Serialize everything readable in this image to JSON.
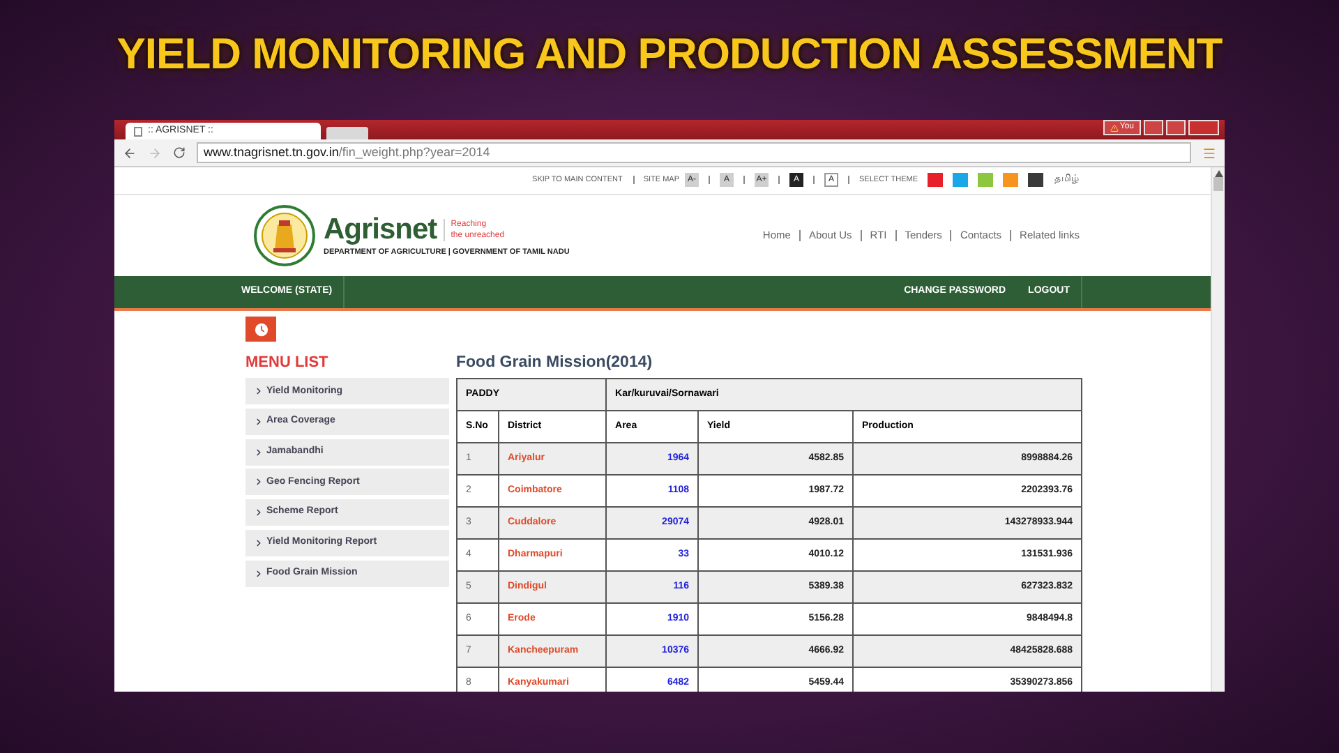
{
  "slide": {
    "title": "YIELD MONITORING AND PRODUCTION ASSESSMENT"
  },
  "browser": {
    "tab_title": ":: AGRISNET ::",
    "profile": "You",
    "url_host": "www.tnagrisnet.tn.gov.in",
    "url_path": "/fin_weight.php?year=2014"
  },
  "utility_bar": {
    "skip_link": "SKIP TO MAIN CONTENT",
    "site_map": "SITE MAP",
    "font_buttons": [
      {
        "label": "A-",
        "kind": "light"
      },
      {
        "label": "A",
        "kind": "light"
      },
      {
        "label": "A+",
        "kind": "light"
      },
      {
        "label": "A",
        "kind": "dark"
      },
      {
        "label": "A",
        "kind": "white"
      }
    ],
    "theme_label": "SELECT THEME",
    "themes": [
      {
        "color": "#e8202a"
      },
      {
        "color": "#1aa7e8"
      },
      {
        "color": "#8dc63f"
      },
      {
        "color": "#f7941d"
      },
      {
        "color": "#3a3a3a"
      }
    ],
    "language": "தமிழ்"
  },
  "header": {
    "brand": "Agrisnet",
    "tagline": [
      "Reaching",
      "the unreached"
    ],
    "department": "DEPARTMENT OF AGRICULTURE | GOVERNMENT OF TAMIL NADU",
    "links": [
      "Home",
      "About Us",
      "RTI",
      "Tenders",
      "Contacts",
      "Related links"
    ]
  },
  "nav": {
    "welcome": "WELCOME (STATE)",
    "right": [
      "CHANGE PASSWORD",
      "LOGOUT"
    ]
  },
  "menu": {
    "title": "MENU LIST",
    "items": [
      "Yield Monitoring",
      "Area Coverage",
      "Jamabandhi",
      "Geo Fencing Report",
      "Scheme Report",
      "Yield Monitoring Report",
      "Food Grain Mission"
    ]
  },
  "content": {
    "title": "Food Grain Mission(2014)",
    "table": {
      "group_row": [
        "PADDY",
        "Kar/kuruvai/Sornawari"
      ],
      "columns": [
        "S.No",
        "District",
        "Area",
        "Yield",
        "Production"
      ],
      "rows": [
        [
          "1",
          "Ariyalur",
          "1964",
          "4582.85",
          "8998884.26"
        ],
        [
          "2",
          "Coimbatore",
          "1108",
          "1987.72",
          "2202393.76"
        ],
        [
          "3",
          "Cuddalore",
          "29074",
          "4928.01",
          "143278933.944"
        ],
        [
          "4",
          "Dharmapuri",
          "33",
          "4010.12",
          "131531.936"
        ],
        [
          "5",
          "Dindigul",
          "116",
          "5389.38",
          "627323.832"
        ],
        [
          "6",
          "Erode",
          "1910",
          "5156.28",
          "9848494.8"
        ],
        [
          "7",
          "Kancheepuram",
          "10376",
          "4666.92",
          "48425828.688"
        ],
        [
          "8",
          "Kanyakumari",
          "6482",
          "5459.44",
          "35390273.856"
        ]
      ]
    }
  }
}
